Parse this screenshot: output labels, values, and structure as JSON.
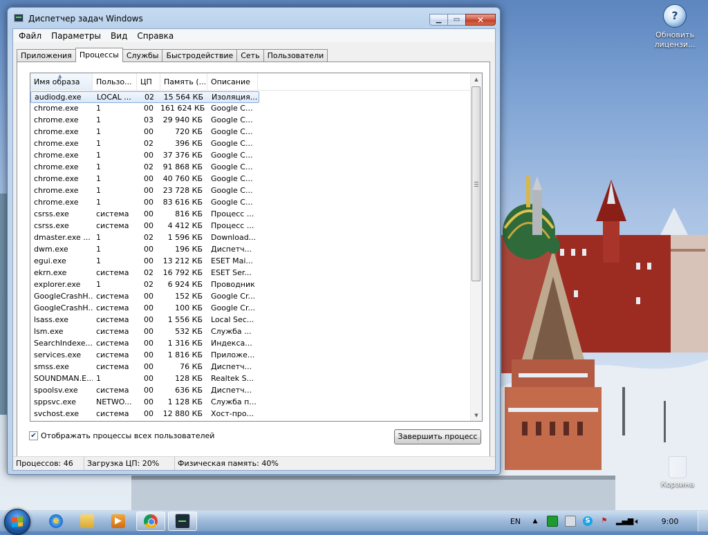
{
  "window": {
    "title": "Диспетчер задач Windows",
    "menu": [
      "Файл",
      "Параметры",
      "Вид",
      "Справка"
    ],
    "tabs": [
      "Приложения",
      "Процессы",
      "Службы",
      "Быстродействие",
      "Сеть",
      "Пользователи"
    ],
    "active_tab": "Процессы",
    "columns": [
      "Имя образа",
      "Пользо...",
      "ЦП",
      "Память (...",
      "Описание"
    ],
    "sorted_column": "Имя образа",
    "processes": [
      {
        "name": "audiodg.exe",
        "user": "LOCAL ...",
        "cpu": "02",
        "mem": "15 564 КБ",
        "desc": "Изоляция...",
        "selected": true
      },
      {
        "name": "chrome.exe",
        "user": "1",
        "cpu": "00",
        "mem": "161 624 КБ",
        "desc": "Google C..."
      },
      {
        "name": "chrome.exe",
        "user": "1",
        "cpu": "03",
        "mem": "29 940 КБ",
        "desc": "Google C..."
      },
      {
        "name": "chrome.exe",
        "user": "1",
        "cpu": "00",
        "mem": "720 КБ",
        "desc": "Google C..."
      },
      {
        "name": "chrome.exe",
        "user": "1",
        "cpu": "02",
        "mem": "396 КБ",
        "desc": "Google C..."
      },
      {
        "name": "chrome.exe",
        "user": "1",
        "cpu": "00",
        "mem": "37 376 КБ",
        "desc": "Google C..."
      },
      {
        "name": "chrome.exe",
        "user": "1",
        "cpu": "02",
        "mem": "91 868 КБ",
        "desc": "Google C..."
      },
      {
        "name": "chrome.exe",
        "user": "1",
        "cpu": "00",
        "mem": "40 760 КБ",
        "desc": "Google C..."
      },
      {
        "name": "chrome.exe",
        "user": "1",
        "cpu": "00",
        "mem": "23 728 КБ",
        "desc": "Google C..."
      },
      {
        "name": "chrome.exe",
        "user": "1",
        "cpu": "00",
        "mem": "83 616 КБ",
        "desc": "Google C..."
      },
      {
        "name": "csrss.exe",
        "user": "система",
        "cpu": "00",
        "mem": "816 КБ",
        "desc": "Процесс ..."
      },
      {
        "name": "csrss.exe",
        "user": "система",
        "cpu": "00",
        "mem": "4 412 КБ",
        "desc": "Процесс ..."
      },
      {
        "name": "dmaster.exe ...",
        "user": "1",
        "cpu": "02",
        "mem": "1 596 КБ",
        "desc": "Download..."
      },
      {
        "name": "dwm.exe",
        "user": "1",
        "cpu": "00",
        "mem": "196 КБ",
        "desc": "Диспетч..."
      },
      {
        "name": "egui.exe",
        "user": "1",
        "cpu": "00",
        "mem": "13 212 КБ",
        "desc": "ESET Mai..."
      },
      {
        "name": "ekrn.exe",
        "user": "система",
        "cpu": "02",
        "mem": "16 792 КБ",
        "desc": "ESET Ser..."
      },
      {
        "name": "explorer.exe",
        "user": "1",
        "cpu": "02",
        "mem": "6 924 КБ",
        "desc": "Проводник"
      },
      {
        "name": "GoogleCrashH...",
        "user": "система",
        "cpu": "00",
        "mem": "152 КБ",
        "desc": "Google Cr..."
      },
      {
        "name": "GoogleCrashH...",
        "user": "система",
        "cpu": "00",
        "mem": "100 КБ",
        "desc": "Google Cr..."
      },
      {
        "name": "lsass.exe",
        "user": "система",
        "cpu": "00",
        "mem": "1 556 КБ",
        "desc": "Local Sec..."
      },
      {
        "name": "lsm.exe",
        "user": "система",
        "cpu": "00",
        "mem": "532 КБ",
        "desc": "Служба ..."
      },
      {
        "name": "SearchIndexe...",
        "user": "система",
        "cpu": "00",
        "mem": "1 316 КБ",
        "desc": "Индекса..."
      },
      {
        "name": "services.exe",
        "user": "система",
        "cpu": "00",
        "mem": "1 816 КБ",
        "desc": "Приложе..."
      },
      {
        "name": "smss.exe",
        "user": "система",
        "cpu": "00",
        "mem": "76 КБ",
        "desc": "Диспетч..."
      },
      {
        "name": "SOUNDMAN.E...",
        "user": "1",
        "cpu": "00",
        "mem": "128 КБ",
        "desc": "Realtek S..."
      },
      {
        "name": "spoolsv.exe",
        "user": "система",
        "cpu": "00",
        "mem": "636 КБ",
        "desc": "Диспетч..."
      },
      {
        "name": "sppsvc.exe",
        "user": "NETWO...",
        "cpu": "00",
        "mem": "1 128 КБ",
        "desc": "Служба п..."
      },
      {
        "name": "svchost.exe",
        "user": "система",
        "cpu": "00",
        "mem": "12 880 КБ",
        "desc": "Хост-про..."
      }
    ],
    "show_all_users_label": "Отображать процессы всех пользователей",
    "show_all_users_checked": true,
    "end_process_label": "Завершить процесс",
    "status": {
      "processes": "Процессов: 46",
      "cpu": "Загрузка ЦП: 20%",
      "memory": "Физическая память: 40%"
    }
  },
  "desktop": {
    "icon_label": "Обновить лицензи...",
    "recycle_label": "Корзина"
  },
  "taskbar": {
    "lang": "EN",
    "clock": "9:00",
    "apps": [
      "internet-explorer",
      "explorer",
      "media-player",
      "chrome",
      "task-manager"
    ]
  },
  "colors": {
    "selection": "#dbe8f8",
    "close_button": "#c44026",
    "title_bar": "#c6dbf2"
  }
}
